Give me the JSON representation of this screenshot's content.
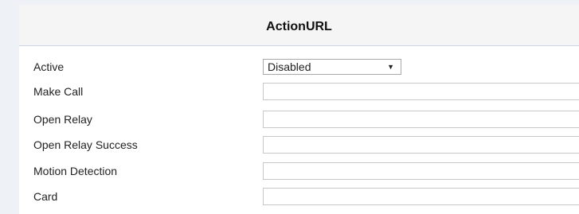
{
  "section": {
    "title": "ActionURL"
  },
  "form": {
    "active": {
      "label": "Active",
      "value": "Disabled",
      "caret": "▼"
    },
    "rows": [
      {
        "label": "Make Call",
        "value": ""
      },
      {
        "label": "Open Relay",
        "value": ""
      },
      {
        "label": "Open Relay Success",
        "value": ""
      },
      {
        "label": "Motion Detection",
        "value": ""
      },
      {
        "label": "Card",
        "value": ""
      }
    ]
  }
}
